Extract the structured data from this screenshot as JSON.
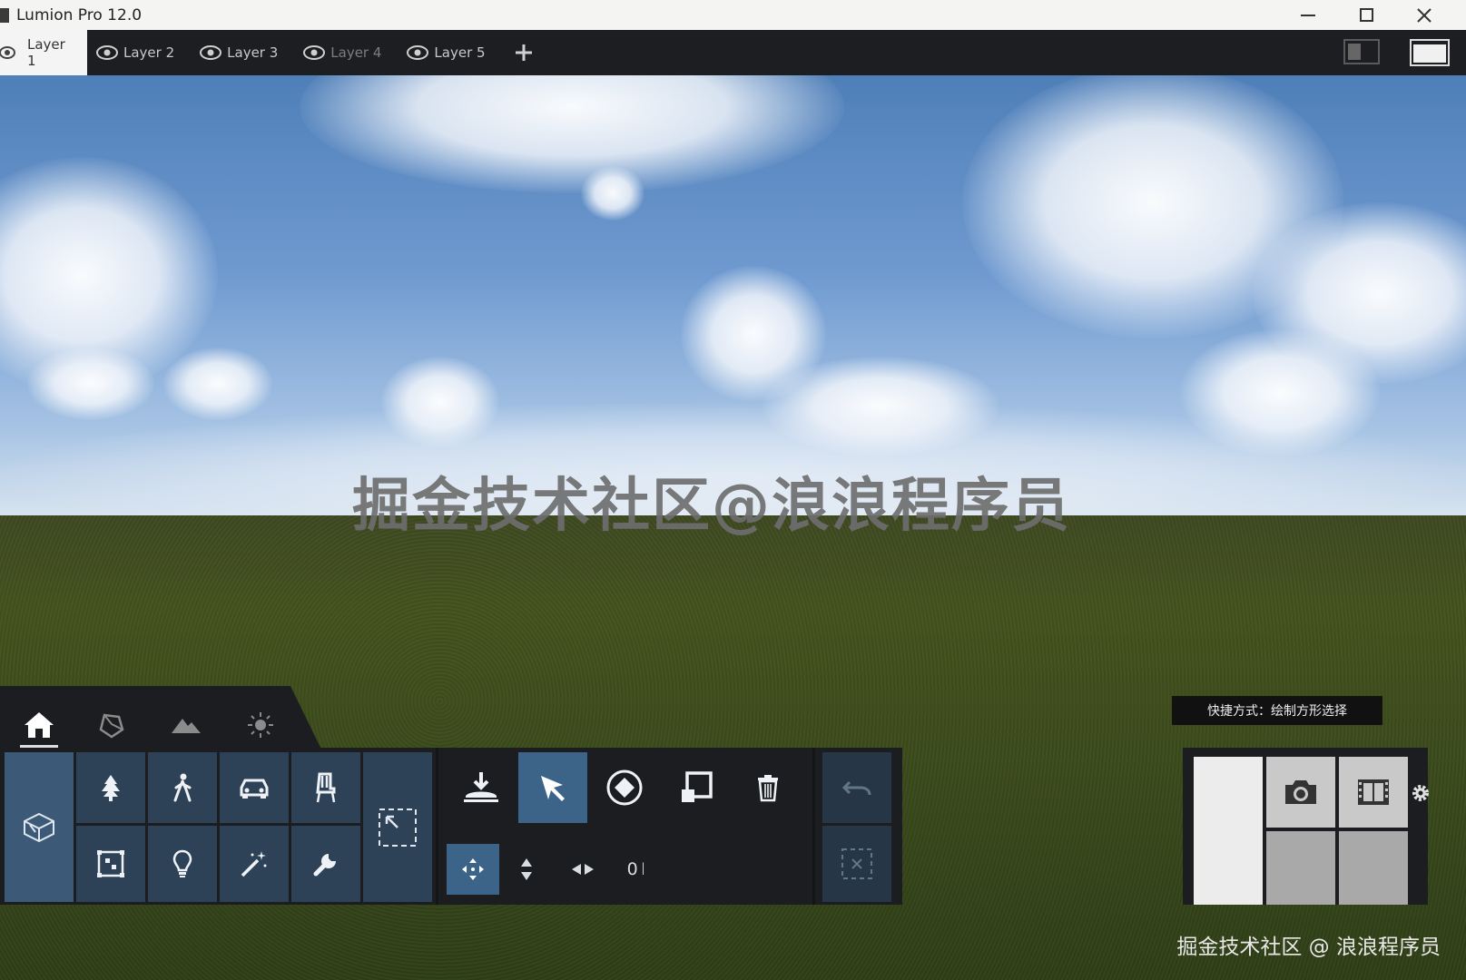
{
  "window": {
    "title": "Lumion Pro 12.0",
    "controls": [
      "minimize-icon",
      "maximize-icon",
      "close-icon"
    ]
  },
  "layers": {
    "tabs": [
      {
        "label": "Layer 1",
        "active": true
      },
      {
        "label": "Layer 2",
        "active": false
      },
      {
        "label": "Layer 3",
        "active": false
      },
      {
        "label": "Layer 4",
        "active": false
      },
      {
        "label": "Layer 5",
        "active": false
      }
    ],
    "add_icon": "plus-icon"
  },
  "viewport": {
    "watermark": "掘金技术社区@浪浪程序员",
    "watermark_corner": "掘金技术社区 @ 浪浪程序员",
    "shortcut_hint": "快捷方式：绘制方形选择"
  },
  "mode_tabs": [
    "home-icon",
    "material-icon",
    "landscape-icon",
    "weather-icon"
  ],
  "object_tools": {
    "categories": [
      "nature-icon",
      "person-icon",
      "car-icon",
      "furniture-icon",
      "effects-object-icon",
      "light-icon",
      "special-effect-icon",
      "utility-icon"
    ],
    "import_icon": "import-model-icon",
    "selection_icon": "box-select-icon"
  },
  "transform_tools": {
    "tools": [
      "place-icon",
      "select-arrow-icon",
      "rotate-icon",
      "scale-icon",
      "delete-icon"
    ],
    "sub_tools": [
      "move-icon",
      "height-icon",
      "horizontal-icon"
    ],
    "count_text": "0"
  },
  "history": [
    "undo-icon",
    "deselect-icon"
  ],
  "render": [
    "camera-icon",
    "movie-icon",
    "settings-icon"
  ],
  "colors": {
    "accent": "#3c5a78",
    "selected": "#3c6388",
    "panel": "#1c1d20"
  }
}
